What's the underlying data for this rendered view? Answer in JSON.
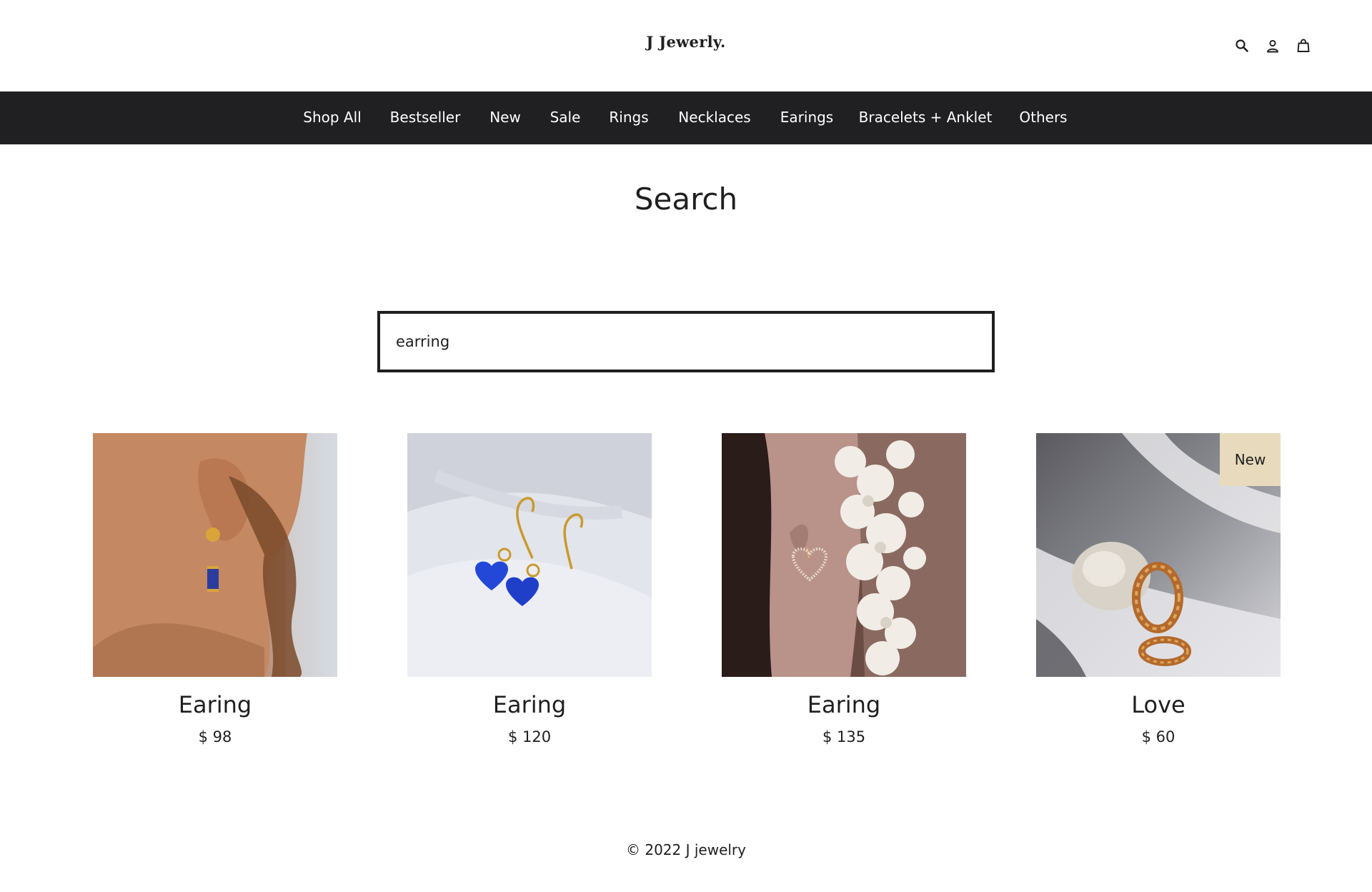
{
  "header": {
    "logo": "J Jewerly.",
    "icons": [
      "search-icon",
      "account-icon",
      "cart-icon"
    ]
  },
  "nav": {
    "items": [
      "Shop All",
      "Bestseller",
      "New",
      "Sale",
      "Rings",
      "Necklaces",
      "Earings",
      "Bracelets + Anklet",
      "Others"
    ]
  },
  "main": {
    "title": "Search",
    "search": {
      "value": "earring",
      "placeholder": ""
    }
  },
  "products": [
    {
      "name": "Earing",
      "price": "$ 98"
    },
    {
      "name": "Earing",
      "price": "$ 120"
    },
    {
      "name": "Earing",
      "price": "$ 135"
    },
    {
      "name": "Love",
      "price": "$ 60",
      "badge": "New"
    }
  ],
  "footer": {
    "copyright": "© 2022 J jewelry"
  },
  "colors": {
    "nav_bg": "#202022",
    "text": "#1f1f21",
    "badge_bg": "#e8dbbd"
  }
}
